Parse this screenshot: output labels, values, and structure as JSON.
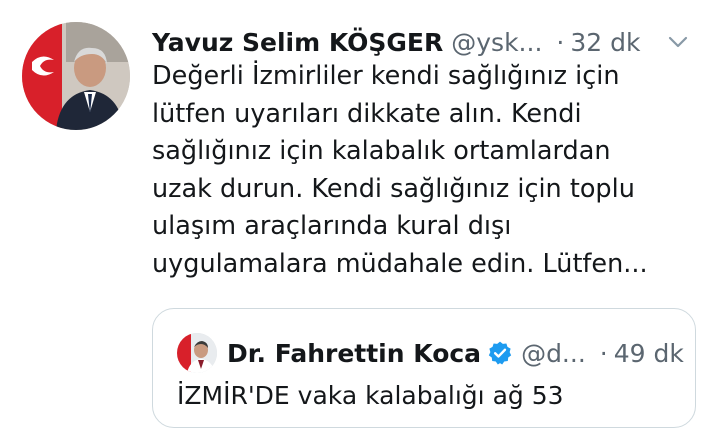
{
  "tweet": {
    "author_name": "Yavuz Selim KÖŞGER",
    "author_handle": "@ysk...",
    "separator": "·",
    "time": "32 dk",
    "lines": [
      "Değerli İzmirliler kendi sağlığınız için",
      "lütfen uyarıları dikkate alın. Kendi",
      "sağlığınız için kalabalık ortamlardan",
      "uzak durun. Kendi sağlığınız için toplu",
      "ulaşım araçlarında kural dışı",
      "uygulamalara müdahale edin. Lütfen..."
    ],
    "menu_icon": "chevron-down-icon"
  },
  "quoted": {
    "author_name": "Dr. Fahrettin Koca",
    "author_handle": "@d...",
    "separator": "·",
    "time": "49 dk",
    "verified_icon": "verified-badge-icon",
    "text": "İZMİR'DE vaka kalabalığı ağ 53"
  },
  "colors": {
    "text_primary": "#14171a",
    "text_secondary": "#5b6670",
    "verified_blue": "#1d9bf0",
    "border": "#cfd9de"
  }
}
